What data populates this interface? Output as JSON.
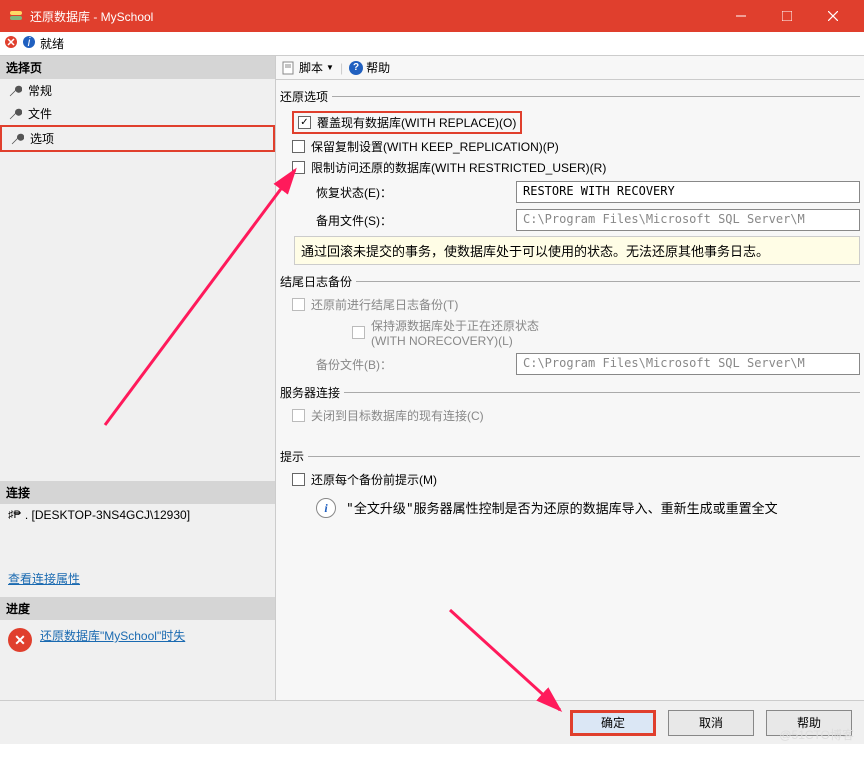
{
  "titlebar": {
    "title": "还原数据库 - MySchool"
  },
  "statusbar": {
    "ready": "就绪"
  },
  "sidebar": {
    "header": "选择页",
    "items": [
      {
        "label": "常规"
      },
      {
        "label": "文件"
      },
      {
        "label": "选项"
      }
    ]
  },
  "connection": {
    "header": "连接",
    "server": ". [DESKTOP-3NS4GCJ\\12930]",
    "view_props": "查看连接属性"
  },
  "progress": {
    "header": "进度",
    "error_text": "还原数据库\"MySchool\"时失"
  },
  "toolbar": {
    "script": "脚本",
    "help": "帮助"
  },
  "restore_options": {
    "legend": "还原选项",
    "overwrite": "覆盖现有数据库(WITH REPLACE)(O)",
    "keep_replication": "保留复制设置(WITH KEEP_REPLICATION)(P)",
    "restricted": "限制访问还原的数据库(WITH RESTRICTED_USER)(R)",
    "recovery_state_label": "恢复状态(E)：",
    "recovery_state_value": "RESTORE WITH RECOVERY",
    "standby_label": "备用文件(S)：",
    "standby_value": "C:\\Program Files\\Microsoft SQL Server\\M",
    "info": "通过回滚未提交的事务，使数据库处于可以使用的状态。无法还原其他事务日志。"
  },
  "tail_log": {
    "legend": "结尾日志备份",
    "backup_before": "还原前进行结尾日志备份(T)",
    "keep_source": "保持源数据库处于正在还原状态",
    "with_norecovery": "(WITH NORECOVERY)(L)",
    "backup_file_label": "备份文件(B)：",
    "backup_file_value": "C:\\Program Files\\Microsoft SQL Server\\M"
  },
  "server_conn": {
    "legend": "服务器连接",
    "close_existing": "关闭到目标数据库的现有连接(C)"
  },
  "prompt": {
    "legend": "提示",
    "before_each": "还原每个备份前提示(M)",
    "hint": "\"全文升级\"服务器属性控制是否为还原的数据库导入、重新生成或重置全文"
  },
  "buttons": {
    "ok": "确定",
    "cancel": "取消",
    "help": "帮助"
  }
}
